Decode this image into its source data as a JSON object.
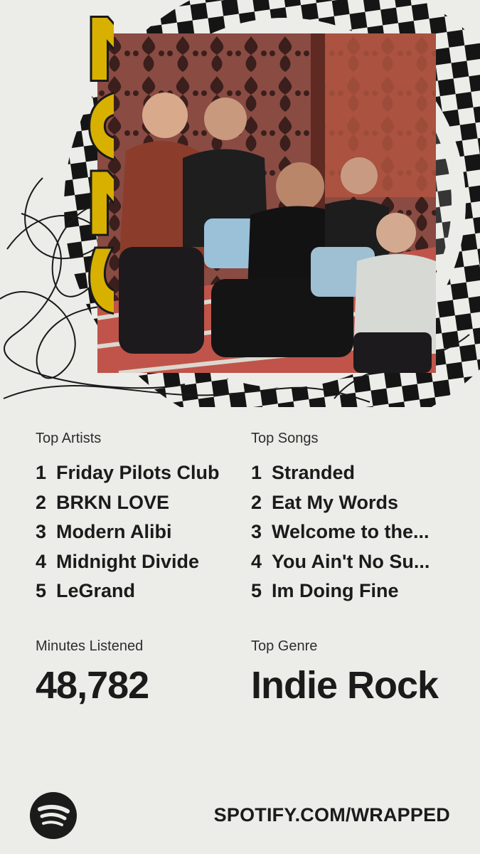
{
  "year_badge": "2025",
  "top_artists": {
    "label": "Top Artists",
    "items": [
      {
        "rank": "1",
        "name": "Friday Pilots Club"
      },
      {
        "rank": "2",
        "name": "BRKN LOVE"
      },
      {
        "rank": "3",
        "name": "Modern Alibi"
      },
      {
        "rank": "4",
        "name": "Midnight Divide"
      },
      {
        "rank": "5",
        "name": "LeGrand"
      }
    ]
  },
  "top_songs": {
    "label": "Top Songs",
    "items": [
      {
        "rank": "1",
        "name": "Stranded"
      },
      {
        "rank": "2",
        "name": "Eat My Words"
      },
      {
        "rank": "3",
        "name": "Welcome to the..."
      },
      {
        "rank": "4",
        "name": "You Ain't No Su..."
      },
      {
        "rank": "5",
        "name": "Im Doing Fine"
      }
    ]
  },
  "minutes_listened": {
    "label": "Minutes Listened",
    "value": "48,782"
  },
  "top_genre": {
    "label": "Top Genre",
    "value": "Indie Rock"
  },
  "footer": {
    "logo_icon": "spotify-logo-icon",
    "url": "SPOTIFY.COM/WRAPPED"
  },
  "colors": {
    "background": "#ecece8",
    "accent_yellow": "#d8b000",
    "text": "#1b1b1b",
    "checker": "#151515"
  }
}
